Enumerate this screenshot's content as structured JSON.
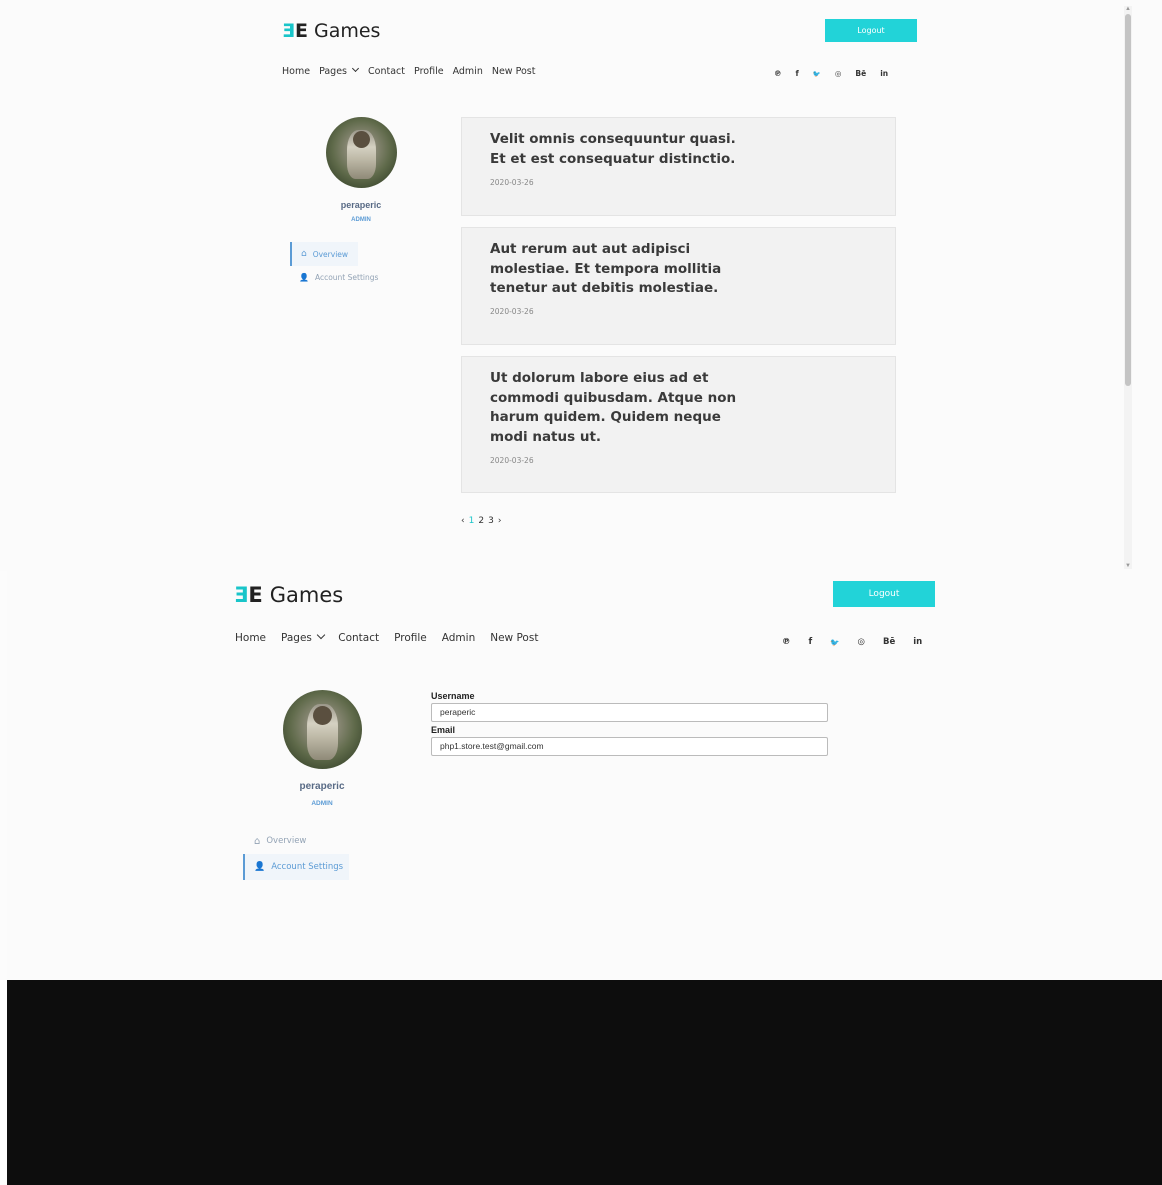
{
  "brand": {
    "mark_left": "Ǝ",
    "mark_right": "E",
    "name": "Games"
  },
  "header": {
    "logout_label": "Logout"
  },
  "nav": {
    "home": "Home",
    "pages": "Pages",
    "contact": "Contact",
    "profile": "Profile",
    "admin": "Admin",
    "new_post": "New Post"
  },
  "social": {
    "pinterest": "℗",
    "facebook": "f",
    "twitter": "🐦",
    "dribbble": "◎",
    "behance": "Bē",
    "linkedin": "in"
  },
  "profile": {
    "username": "peraperic",
    "role": "ADMIN"
  },
  "sidebar": {
    "overview": "Overview",
    "account_settings": "Account Settings"
  },
  "posts": [
    {
      "title": "Velit omnis consequuntur quasi. Et et est consequatur distinctio.",
      "date": "2020-03-26"
    },
    {
      "title": "Aut rerum aut aut adipisci molestiae. Et tempora mollitia tenetur aut debitis molestiae.",
      "date": "2020-03-26"
    },
    {
      "title": "Ut dolorum labore eius ad et commodi quibusdam. Atque non harum quidem. Quidem neque modi natus ut.",
      "date": "2020-03-26"
    }
  ],
  "pagination": {
    "prev": "‹",
    "pages": [
      "1",
      "2",
      "3"
    ],
    "current": "1",
    "next": "›"
  },
  "account_form": {
    "username_label": "Username",
    "username_value": "peraperic",
    "email_label": "Email",
    "email_value": "php1.store.test@gmail.com"
  },
  "colors": {
    "accent": "#22d3d8",
    "link_blue": "#5b9bd5",
    "username": "#586a85"
  }
}
